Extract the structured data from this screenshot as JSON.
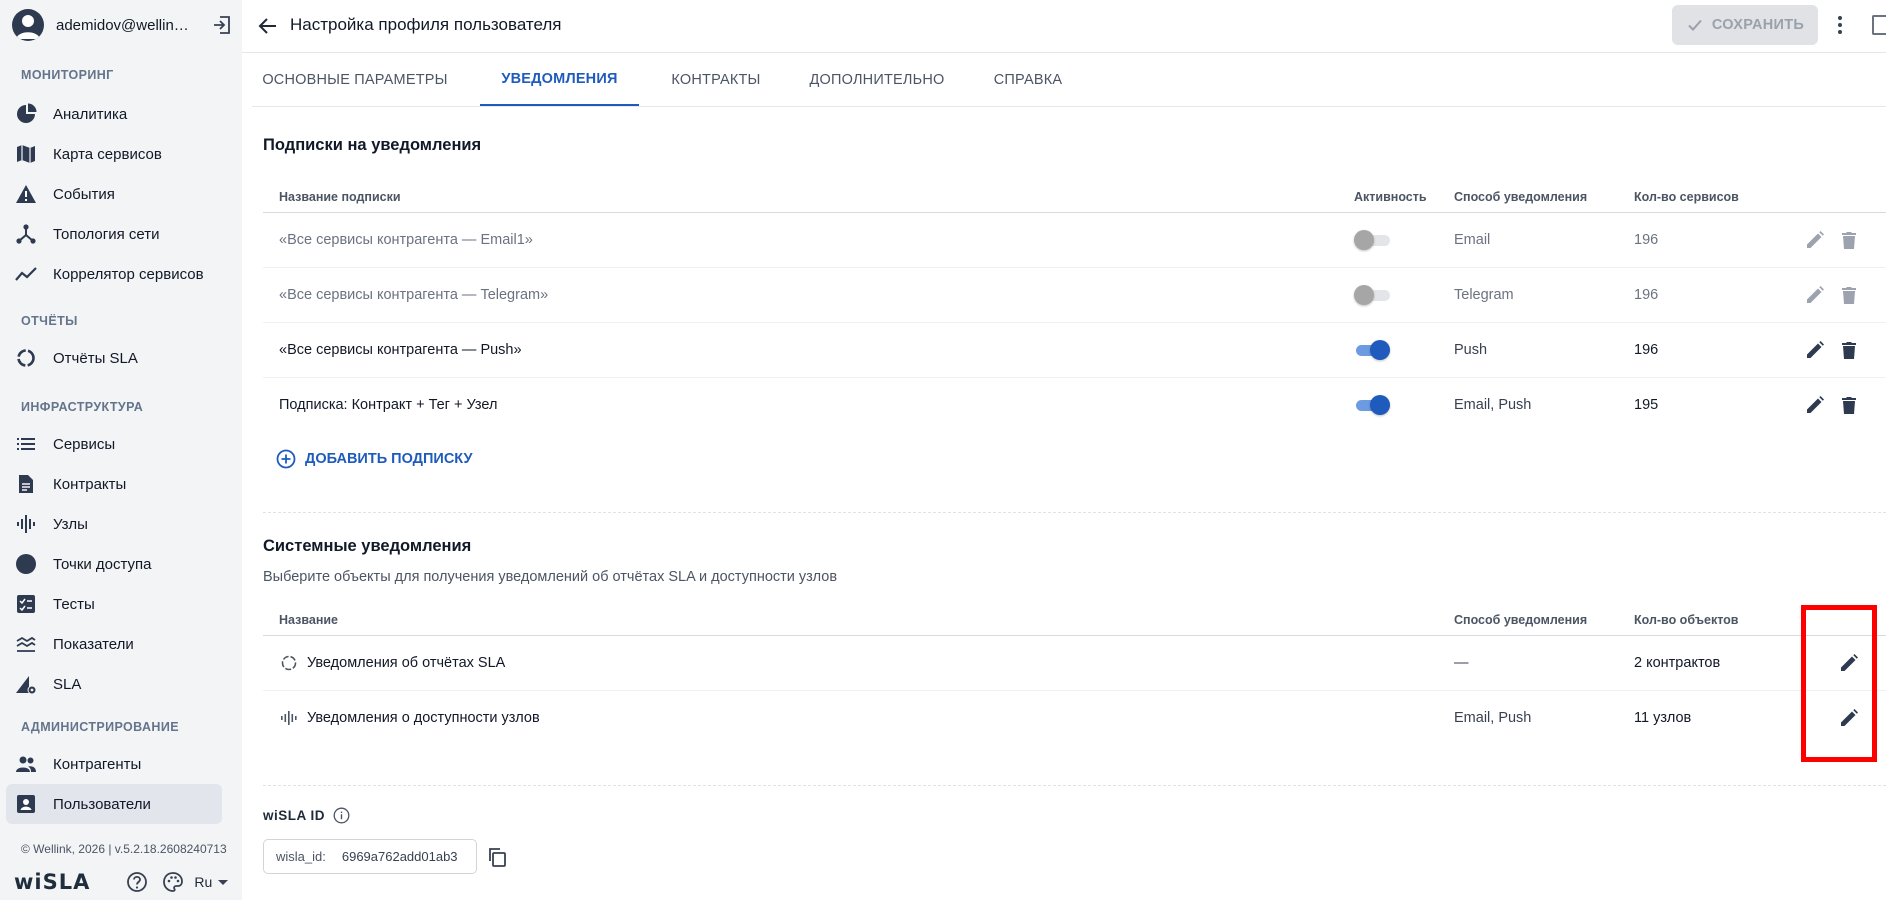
{
  "user": {
    "email": "ademidov@wellink..."
  },
  "sidebar": {
    "sections": {
      "monitoring": "МОНИТОРИНГ",
      "reports": "ОТЧЁТЫ",
      "infrastructure": "ИНФРАСТРУКТУРА",
      "administration": "АДМИНИСТРИРОВАНИЕ"
    },
    "items": {
      "analytics": "Аналитика",
      "service_map": "Карта сервисов",
      "events": "События",
      "topology": "Топология сети",
      "correlator": "Коррелятор сервисов",
      "sla_reports": "Отчёты SLA",
      "services": "Сервисы",
      "contracts": "Контракты",
      "nodes": "Узлы",
      "access_points": "Точки доступа",
      "tests": "Тесты",
      "indicators": "Показатели",
      "sla": "SLA",
      "counterparties": "Контрагенты",
      "users": "Пользователи"
    },
    "active_item": "users",
    "copyright": "© Wellink, 2026 | v.5.2.18.2608240713",
    "logo": "wiSLA",
    "language": "Ru"
  },
  "header": {
    "title": "Настройка профиля пользователя",
    "save_label": "СОХРАНИТЬ"
  },
  "tabs": [
    {
      "label": "ОСНОВНЫЕ ПАРАМЕТРЫ",
      "active": false
    },
    {
      "label": "УВЕДОМЛЕНИЯ",
      "active": true
    },
    {
      "label": "КОНТРАКТЫ",
      "active": false
    },
    {
      "label": "ДОПОЛНИТЕЛЬНО",
      "active": false
    },
    {
      "label": "СПРАВКА",
      "active": false
    }
  ],
  "subscriptions": {
    "title": "Подписки на уведомления",
    "columns": {
      "name": "Название подписки",
      "activity": "Активность",
      "method": "Способ уведомления",
      "count": "Кол-во сервисов"
    },
    "rows": [
      {
        "name": "«Все сервисы контрагента — Email1»",
        "active": false,
        "method": "Email",
        "count": "196"
      },
      {
        "name": "«Все сервисы контрагента — Telegram»",
        "active": false,
        "method": "Telegram",
        "count": "196"
      },
      {
        "name": "«Все сервисы контрагента — Push»",
        "active": true,
        "method": "Push",
        "count": "196"
      },
      {
        "name": "Подписка: Контракт + Тег + Узел",
        "active": true,
        "method": "Email, Push",
        "count": "195"
      }
    ],
    "add_label": "ДОБАВИТЬ ПОДПИСКУ"
  },
  "system": {
    "title": "Системные уведомления",
    "subtitle": "Выберите объекты для получения уведомлений об отчётах SLA и доступности узлов",
    "columns": {
      "name": "Название",
      "method": "Способ уведомления",
      "count": "Кол-во объектов"
    },
    "rows": [
      {
        "name": "Уведомления об отчётах SLA",
        "icon": "sla-report-icon",
        "method": "—",
        "count": "2 контрактов"
      },
      {
        "name": "Уведомления о доступности узлов",
        "icon": "nodes-icon",
        "method": "Email, Push",
        "count": "11 узлов"
      }
    ]
  },
  "wisla_id": {
    "label": "wiSLA ID",
    "key": "wisla_id:",
    "value": "6969a762add01ab3"
  },
  "colors": {
    "accent": "#1e5bbd",
    "sidebar_bg": "#f3f4f6",
    "highlight": "#ff0000"
  }
}
